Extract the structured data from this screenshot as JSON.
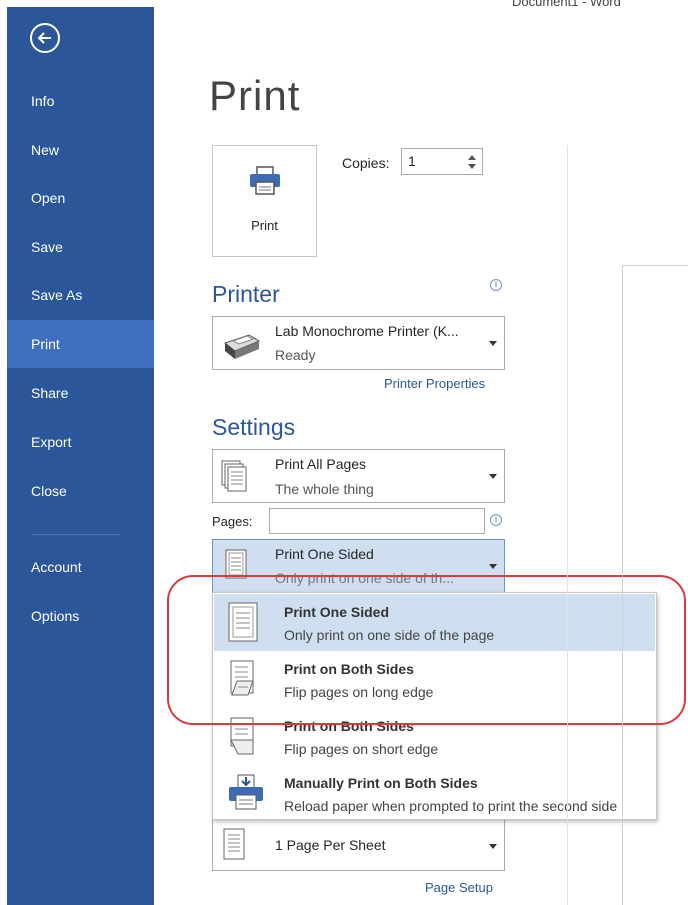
{
  "window": {
    "title": "Document1 - Word"
  },
  "sidebar": {
    "items": [
      {
        "label": "Info"
      },
      {
        "label": "New"
      },
      {
        "label": "Open"
      },
      {
        "label": "Save"
      },
      {
        "label": "Save As"
      },
      {
        "label": "Print"
      },
      {
        "label": "Share"
      },
      {
        "label": "Export"
      },
      {
        "label": "Close"
      },
      {
        "label": "Account"
      },
      {
        "label": "Options"
      }
    ],
    "active": "Print"
  },
  "page": {
    "title": "Print"
  },
  "print": {
    "button_label": "Print",
    "copies_label": "Copies:",
    "copies_value": "1"
  },
  "printer": {
    "heading": "Printer",
    "name": "Lab Monochrome Printer (K...",
    "status": "Ready",
    "properties_link": "Printer Properties"
  },
  "settings": {
    "heading": "Settings",
    "range": {
      "title": "Print All Pages",
      "subtitle": "The whole thing"
    },
    "pages_label": "Pages:",
    "pages_value": "",
    "sides": {
      "title": "Print One Sided",
      "subtitle": "Only print on one side of th..."
    },
    "sides_options": [
      {
        "title": "Print One Sided",
        "subtitle": "Only print on one side of the page"
      },
      {
        "title": "Print on Both Sides",
        "subtitle": "Flip pages on long edge"
      },
      {
        "title": "Print on Both Sides",
        "subtitle": "Flip pages on short edge"
      },
      {
        "title": "Manually Print on Both Sides",
        "subtitle": "Reload paper when prompted to print the second side"
      }
    ],
    "per_sheet": {
      "title": "1 Page Per Sheet"
    },
    "page_setup_link": "Page Setup"
  },
  "colors": {
    "sidebar": "#2b579a",
    "sidebar_active": "#3f6fbf",
    "selection": "#cfdff0",
    "highlight_oval": "#d93b3b"
  },
  "icons": [
    "back-arrow-icon",
    "printer-icon",
    "info-icon",
    "pages-icon",
    "one-sided-icon",
    "both-sides-long-icon",
    "both-sides-short-icon",
    "manual-duplex-icon",
    "page-per-sheet-icon"
  ]
}
